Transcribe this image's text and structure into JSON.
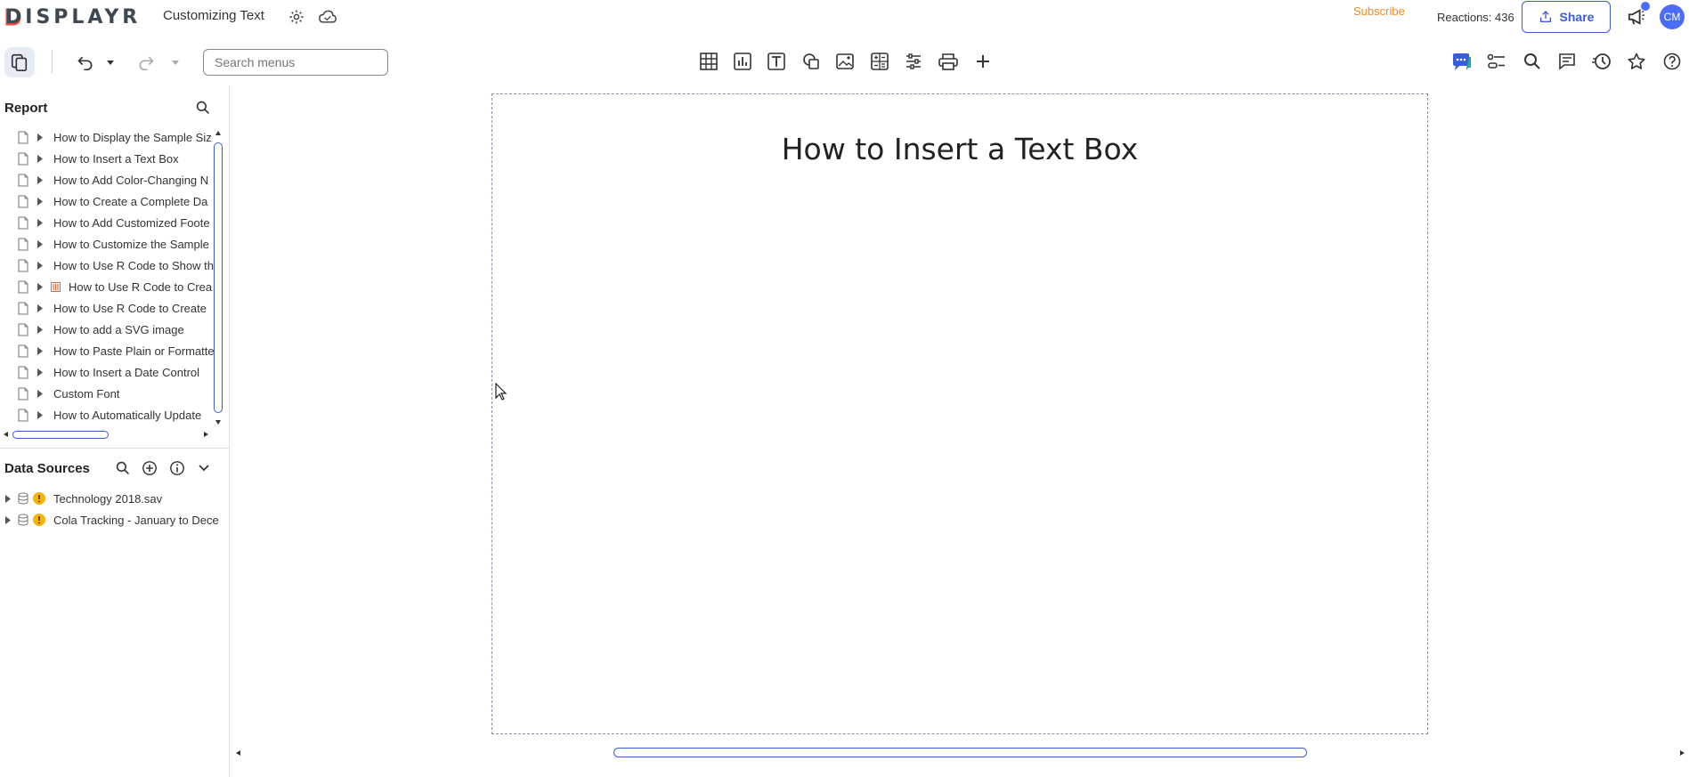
{
  "app": {
    "logo": "DISPLAYR",
    "doc_title": "Customizing Text",
    "subscribe": "Subscribe",
    "reactions": "Reactions: 436",
    "share": "Share",
    "avatar_initials": "CM",
    "accent": "#3b5bdb",
    "subscribe_color": "#f08a24"
  },
  "toolbar": {
    "search_placeholder": "Search menus",
    "center_icons": [
      "table-icon",
      "chart-icon",
      "text-icon",
      "shapes-icon",
      "image-icon",
      "calculator-icon",
      "filter-sliders-icon",
      "print-icon",
      "plus-icon"
    ],
    "right_icons": [
      "chat-icon",
      "settings-toggle-icon",
      "search-icon",
      "comment-icon",
      "history-icon",
      "star-icon",
      "help-icon"
    ]
  },
  "report": {
    "heading": "Report",
    "items": [
      {
        "label": "How to Display the Sample Siz"
      },
      {
        "label": "How to Insert a Text Box"
      },
      {
        "label": "How to Add Color-Changing N"
      },
      {
        "label": "How to Create a Complete Da"
      },
      {
        "label": "How to Add Customized Foote"
      },
      {
        "label": "How to Customize the Sample"
      },
      {
        "label": "How to Use R Code to Show th"
      },
      {
        "label": "How to Use R Code to Crea"
      },
      {
        "label": "How to Use R Code to Create"
      },
      {
        "label": "How to add a SVG image"
      },
      {
        "label": "How to Paste Plain or Formatte"
      },
      {
        "label": "How to Insert a Date Control"
      },
      {
        "label": "Custom Font"
      },
      {
        "label": "How to Automatically Update"
      }
    ]
  },
  "data_sources": {
    "heading": "Data Sources",
    "items": [
      {
        "label": "Technology 2018.sav"
      },
      {
        "label": "Cola Tracking - January to Dece"
      }
    ]
  },
  "canvas": {
    "title": "How to Insert a Text Box"
  }
}
